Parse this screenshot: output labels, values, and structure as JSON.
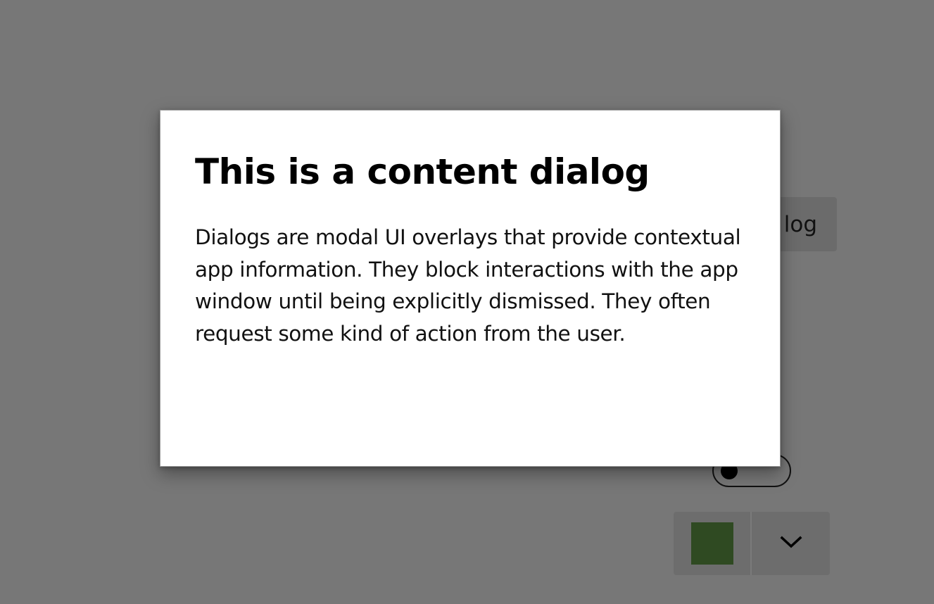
{
  "background": {
    "dialog_button_label": "log",
    "color_swatch": "#2f4a22",
    "dropdown_icon": "chevron-down-icon"
  },
  "dialog": {
    "title": "This is a content dialog",
    "body": "Dialogs are modal UI overlays that provide contextual app information. They block interactions with the app window until being explicitly dismissed. They often request some kind of action from the user."
  }
}
